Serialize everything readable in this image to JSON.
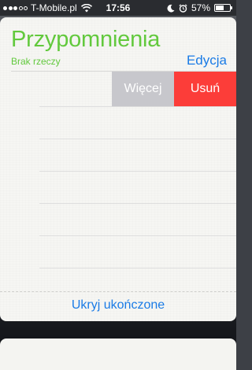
{
  "status_bar": {
    "carrier": "T-Mobile.pl",
    "signal_bars_filled": 3,
    "signal_bars_total": 5,
    "time": "17:56",
    "battery_percent_label": "57%",
    "battery_level": 0.57,
    "icons": [
      "wifi-icon",
      "moon-icon",
      "alarm-icon",
      "battery-icon"
    ]
  },
  "reminders": {
    "title": "Przypomnienia",
    "subtitle": "Brak rzeczy",
    "edit_label": "Edycja",
    "swipe_actions": {
      "more_label": "Więcej",
      "delete_label": "Usuń"
    },
    "hide_completed_label": "Ukryj ukończone"
  },
  "colors": {
    "accent_green": "#62c93d",
    "link_blue": "#1a7be6",
    "delete_red": "#fc3d39",
    "more_gray": "#c7c7cc"
  }
}
